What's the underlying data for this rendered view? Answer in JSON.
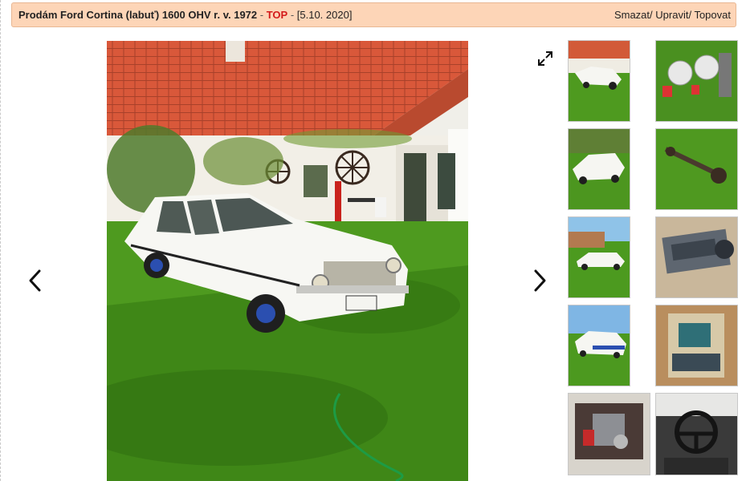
{
  "header": {
    "title": "Prodám Ford Cortina (labuť) 1600 OHV r. v. 1972",
    "dash1": " - ",
    "top_badge": "TOP",
    "dash2": " - ",
    "date": "[5.10. 2020]",
    "actions": [
      "Smazat/",
      "Upravit/",
      "Topovat"
    ]
  },
  "gallery": {
    "main_photo": "white-ford-cortina-on-lawn-photo",
    "prev_icon": "chevron-left-icon",
    "next_icon": "chevron-right-icon",
    "fullscreen_icon": "expand-icon",
    "thumbnails": [
      "car-front-house-thumb",
      "wheels-parts-thumb",
      "car-side-garden-thumb",
      "rear-axle-grass-thumb",
      "car-distance-thumb",
      "engine-block-thumb",
      "car-rear-sky-thumb",
      "car-interior-parts-thumb",
      "engine-bay-thumb",
      "steering-wheel-thumb"
    ]
  },
  "colors": {
    "header_bg": "#fdd5b7",
    "top_badge": "#d41b1b"
  }
}
